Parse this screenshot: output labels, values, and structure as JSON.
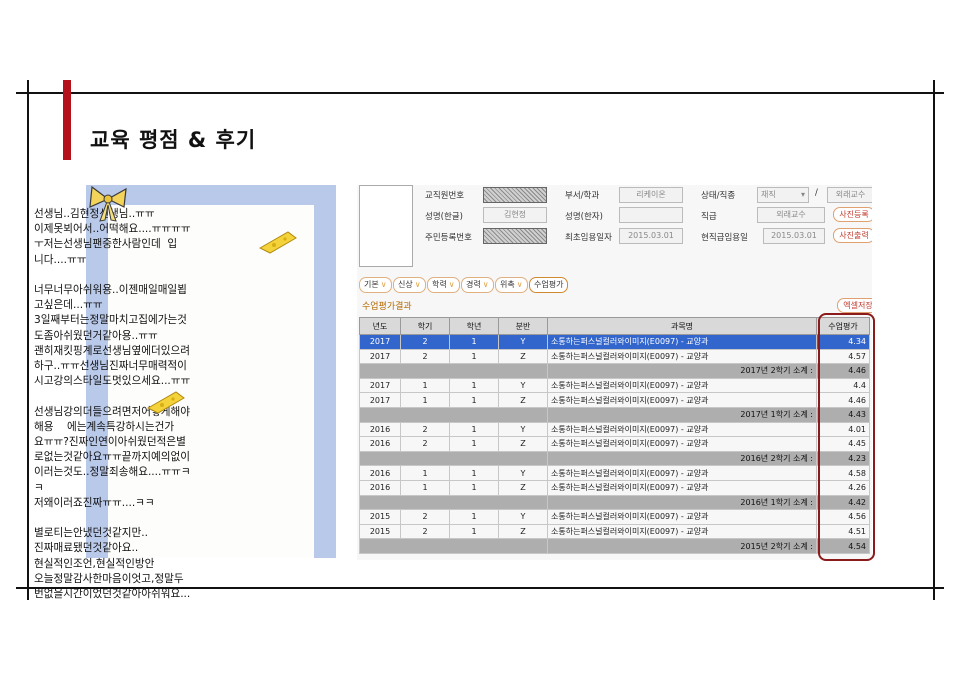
{
  "slide": {
    "title": "교육 평점 & 후기"
  },
  "note": {
    "text": "선생님..김현정선생님..ㅠㅠ\n이제못뵈어서..어떡해요....ㅠㅠㅠㅠ\nㅜ저는선생님팬중한사람인데  입\n니다....ㅠㅠ\n\n너무너무아쉬워용..이젠매일매일뵙\n고싶은데...ㅠㅠ\n3일째부터는정말마치고집에가는것\n도좀아쉬웠던거같아용..ㅠㅠ\n괜히재킷핑계로선생님옆에더있으려\n하구..ㅠㅠ선생님진짜너무매력적이\n시고강의스타일도멋있으세요...ㅠㅠ\n\n선생님강의더들으려면저어떻게해야\n해용    에는계속특강하시는건가\n요ㅠㅠ?진짜인연이아쉬웠던적은별\n로없는것같아요ㅠㅠ끝까지예의없이\n이러는것도..정말죄송해요....ㅠㅠㅋ\nㅋ\n저왜이러죠진짜ㅠㅠ....ㅋㅋ\n\n별로티는안냈던것같지만..\n진짜매료됐던것같아요..\n현실적인조언,현실적인방안\n오늘정말감사한마음이엇고,정말두\n번없을시간이었던것같아아쉬워요..."
  },
  "erp": {
    "labels": {
      "staff_no": "교직원번호",
      "name_kr": "성명(한글)",
      "resident_no": "주민등록번호",
      "dept": "부서/학과",
      "name_hanja": "성명(한자)",
      "first_hire": "최초임용일자",
      "status": "상태/직종",
      "grade": "직급",
      "current_hire": "현직급임용일",
      "slash": "/"
    },
    "values": {
      "name_kr": "김현정",
      "dept": "리케이온",
      "first_hire": "2015.03.01",
      "status": "재직",
      "status_type": "외래교수",
      "grade": "외래교수",
      "current_hire": "2015.03.01"
    },
    "buttons": {
      "photo_register": "사진등록",
      "photo_print": "사진출력",
      "excel_save": "엑셀저장"
    },
    "tabs": [
      "기본",
      "신상",
      "학력",
      "경력",
      "위촉",
      "수업평가"
    ],
    "section_title": "수업평가결과",
    "columns": [
      "년도",
      "학기",
      "학년",
      "분반",
      "과목명",
      "수업평가"
    ],
    "course": "소통하는퍼스널컬러와이미지(E0097) - 교양과",
    "rows": [
      {
        "type": "data",
        "year": "2017",
        "term": "2",
        "grade": "1",
        "section": "Y",
        "score": "4.34",
        "sel": true
      },
      {
        "type": "data",
        "year": "2017",
        "term": "2",
        "grade": "1",
        "section": "Z",
        "score": "4.57"
      },
      {
        "type": "sub",
        "label": "2017년 2학기  소계 :",
        "score": "4.46"
      },
      {
        "type": "data",
        "year": "2017",
        "term": "1",
        "grade": "1",
        "section": "Y",
        "score": "4.4"
      },
      {
        "type": "data",
        "year": "2017",
        "term": "1",
        "grade": "1",
        "section": "Z",
        "score": "4.46"
      },
      {
        "type": "sub",
        "label": "2017년 1학기  소계 :",
        "score": "4.43"
      },
      {
        "type": "data",
        "year": "2016",
        "term": "2",
        "grade": "1",
        "section": "Y",
        "score": "4.01"
      },
      {
        "type": "data",
        "year": "2016",
        "term": "2",
        "grade": "1",
        "section": "Z",
        "score": "4.45"
      },
      {
        "type": "sub",
        "label": "2016년 2학기  소계 :",
        "score": "4.23"
      },
      {
        "type": "data",
        "year": "2016",
        "term": "1",
        "grade": "1",
        "section": "Y",
        "score": "4.58"
      },
      {
        "type": "data",
        "year": "2016",
        "term": "1",
        "grade": "1",
        "section": "Z",
        "score": "4.26"
      },
      {
        "type": "sub",
        "label": "2016년 1학기  소계 :",
        "score": "4.42"
      },
      {
        "type": "data",
        "year": "2015",
        "term": "2",
        "grade": "1",
        "section": "Y",
        "score": "4.56"
      },
      {
        "type": "data",
        "year": "2015",
        "term": "2",
        "grade": "1",
        "section": "Z",
        "score": "4.51"
      },
      {
        "type": "sub",
        "label": "2015년 2학기  소계 :",
        "score": "4.54"
      }
    ]
  },
  "colors": {
    "accent": "#b3121d",
    "highlight": "#8b1a1a",
    "selected_row": "#3366cc",
    "subtotal_row": "#aeaeae",
    "note_background": "#b9c9ea"
  }
}
